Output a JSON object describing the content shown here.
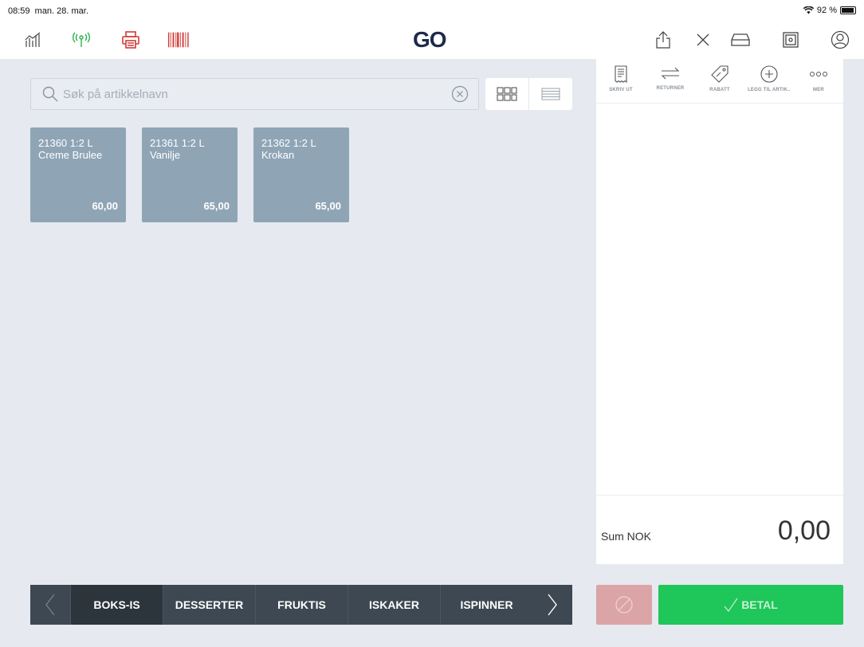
{
  "status": {
    "time": "08:59",
    "date": "man. 28. mar.",
    "battery": "92 %"
  },
  "toolbar": {
    "logo": "GO",
    "left_icons": [
      "stats-icon",
      "antenna-icon",
      "printer-icon",
      "barcode-icon"
    ],
    "right_icons": [
      "share-icon",
      "close-icon",
      "drawer-icon",
      "safe-icon",
      "user-icon"
    ]
  },
  "search": {
    "placeholder": "Søk på artikkelnavn",
    "value": ""
  },
  "products": [
    {
      "name": "21360 1:2 L Creme Brulee",
      "price": "60,00"
    },
    {
      "name": "21361 1:2 L Vanilje",
      "price": "65,00"
    },
    {
      "name": "21362 1:2 L Krokan",
      "price": "65,00"
    }
  ],
  "actions": [
    {
      "label": "SKRIV UT",
      "icon": "receipt-icon"
    },
    {
      "label": "RETURNER",
      "icon": "return-icon"
    },
    {
      "label": "RABATT",
      "icon": "discount-tag-icon"
    },
    {
      "label": "LEGG TIL ARTIK..",
      "icon": "plus-circle-icon"
    },
    {
      "label": "MER",
      "icon": "more-icon"
    }
  ],
  "sum": {
    "label": "Sum NOK",
    "value": "0,00"
  },
  "categories": [
    "BOKS-IS",
    "DESSERTER",
    "FRUKTIS",
    "ISKAKER",
    "ISPINNER"
  ],
  "active_category": "BOKS-IS",
  "pay_label": "BETAL",
  "colors": {
    "pay": "#1fc65a",
    "cancel": "#dba4a7",
    "tile": "#8fa5b6",
    "catbar": "#3d4852"
  }
}
